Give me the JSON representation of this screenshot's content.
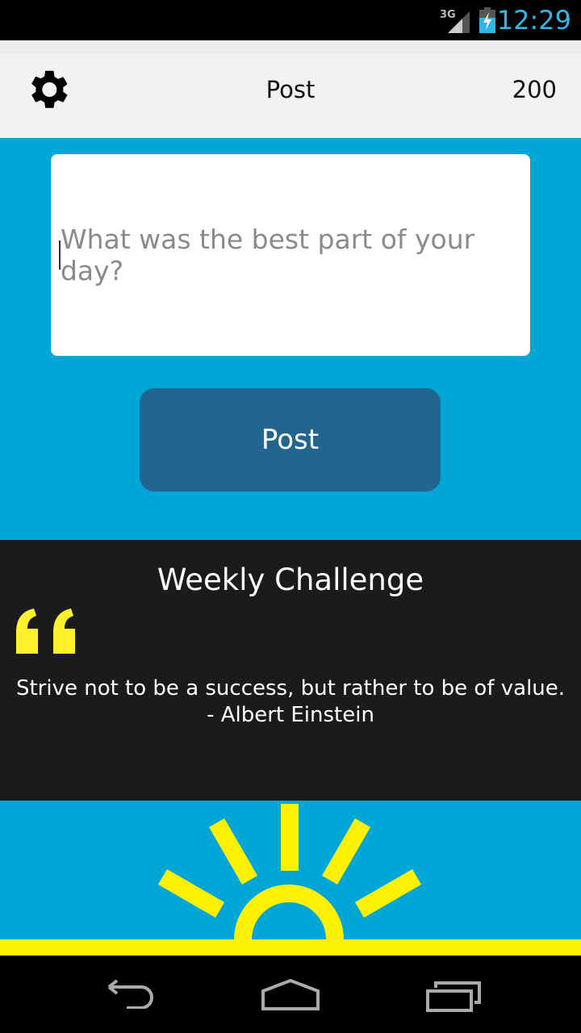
{
  "status_bar": {
    "network": "3G",
    "time": "12:29",
    "icons": [
      "signal-icon",
      "battery-charging-icon"
    ]
  },
  "header": {
    "title": "Post",
    "count": "200",
    "icon": "gear-icon"
  },
  "composer": {
    "placeholder": "What was the best part of your day?",
    "value": "",
    "post_label": "Post"
  },
  "challenge": {
    "title": "Weekly Challenge",
    "quote": "Strive not to be a success, but rather to be of value.",
    "author": "- Albert Einstein"
  },
  "colors": {
    "primary": "#00a7d6",
    "button": "#22658f",
    "accent": "#fff200",
    "dark": "#1a1c1a"
  },
  "nav": {
    "icons": [
      "back-icon",
      "home-icon",
      "recents-icon"
    ]
  }
}
